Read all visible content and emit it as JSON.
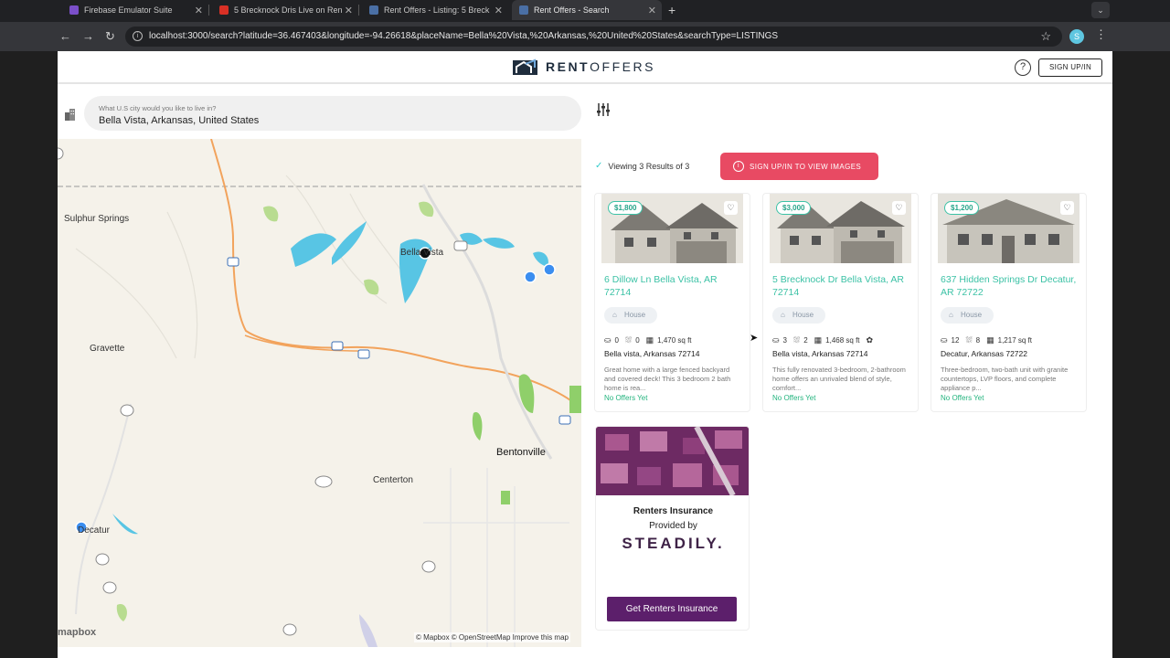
{
  "browser": {
    "tabs": [
      {
        "title": "Firebase Emulator Suite",
        "favicon_color": "#7b4fc9"
      },
      {
        "title": "5 Brecknock Dris Live on Ren",
        "favicon_color": "#d93025"
      },
      {
        "title": "Rent Offers - Listing: 5 Breck",
        "favicon_color": "#4a6fa5"
      },
      {
        "title": "Rent Offers - Search",
        "favicon_color": "#4a6fa5"
      }
    ],
    "url": "localhost:3000/search?latitude=36.467403&longitude=-94.26618&placeName=Bella%20Vista,%20Arkansas,%20United%20States&searchType=LISTINGS",
    "extension_letter": "S"
  },
  "header": {
    "brand_bold": "RENT",
    "brand_light": "OFFERS",
    "help": "?",
    "signup": "SIGN UP/IN"
  },
  "search": {
    "label": "What U.S city would you like to live in?",
    "value": "Bella Vista, Arkansas, United States"
  },
  "map": {
    "labels": {
      "sulphur": "Sulphur Springs",
      "bella": "Bella Vista",
      "gravette": "Gravette",
      "bentonville": "Bentonville",
      "centerton": "Centerton",
      "decatur": "Decatur"
    },
    "attribution": "© Mapbox © OpenStreetMap  Improve this map",
    "logo": "mapbox"
  },
  "results": {
    "viewing": "Viewing 3 Results of 3",
    "view_images": "SIGN UP/IN TO VIEW IMAGES",
    "listings": [
      {
        "price": "$1,800",
        "address": "6 Dillow Ln Bella Vista, AR 72714",
        "type": "House",
        "beds": "0",
        "baths": "0",
        "sqft": "1,470 sq ft",
        "city": "Bella vista, Arkansas 72714",
        "description": "Great home with a large fenced backyard and covered deck! This 3 bedroom 2 bath home is rea...",
        "offers": "No Offers Yet"
      },
      {
        "price": "$3,000",
        "address": "5 Brecknock Dr Bella Vista, AR 72714",
        "type": "House",
        "beds": "3",
        "baths": "2",
        "sqft": "1,468 sq ft",
        "city": "Bella vista, Arkansas 72714",
        "description": "This fully renovated 3-bedroom, 2-bathroom home offers an unrivaled blend of style, comfort...",
        "offers": "No Offers Yet"
      },
      {
        "price": "$1,200",
        "address": "637 Hidden Springs Dr Decatur, AR 72722",
        "type": "House",
        "beds": "12",
        "baths": "8",
        "sqft": "1,217 sq ft",
        "city": "Decatur, Arkansas 72722",
        "description": "Three-bedroom, two-bath unit with granite countertops, LVP floors, and complete appliance p...",
        "offers": "No Offers Yet"
      }
    ]
  },
  "insurance": {
    "title": "Renters Insurance",
    "provided_by": "Provided by",
    "brand": "STEADILY.",
    "button": "Get Renters Insurance"
  }
}
